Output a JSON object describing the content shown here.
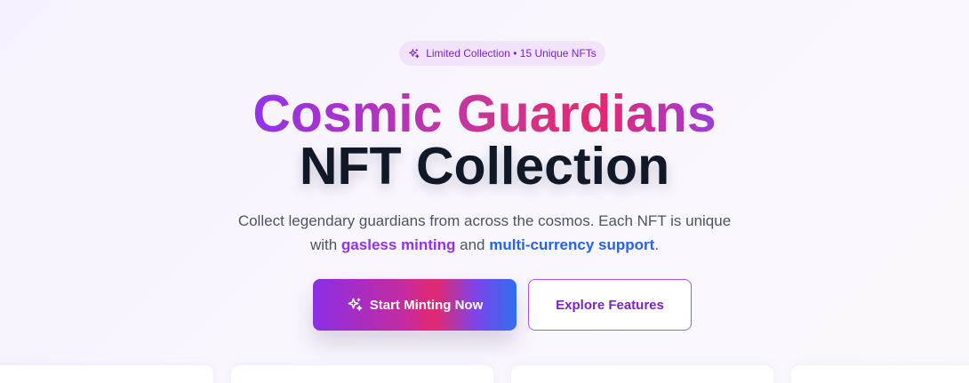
{
  "badge": {
    "icon": "sparkles-icon",
    "text": "Limited Collection • 15 Unique NFTs"
  },
  "hero": {
    "title_gradient": "Cosmic Guardians",
    "title_plain": "NFT Collection",
    "subtitle": {
      "line1": "Collect legendary guardians from across the cosmos. Each NFT is unique",
      "line2_prefix": "with ",
      "highlight1": "gasless minting",
      "connector": " and ",
      "highlight2": "multi-currency support",
      "line2_suffix": "."
    }
  },
  "actions": {
    "primary_label": "Start Minting Now",
    "primary_icon": "sparkles-icon",
    "secondary_label": "Explore Features"
  },
  "colors": {
    "accent_purple": "#9333ea",
    "accent_pink": "#e4286f",
    "accent_blue": "#2563eb",
    "heading_dark": "#111827",
    "badge_bg": "#f1e3fc"
  }
}
